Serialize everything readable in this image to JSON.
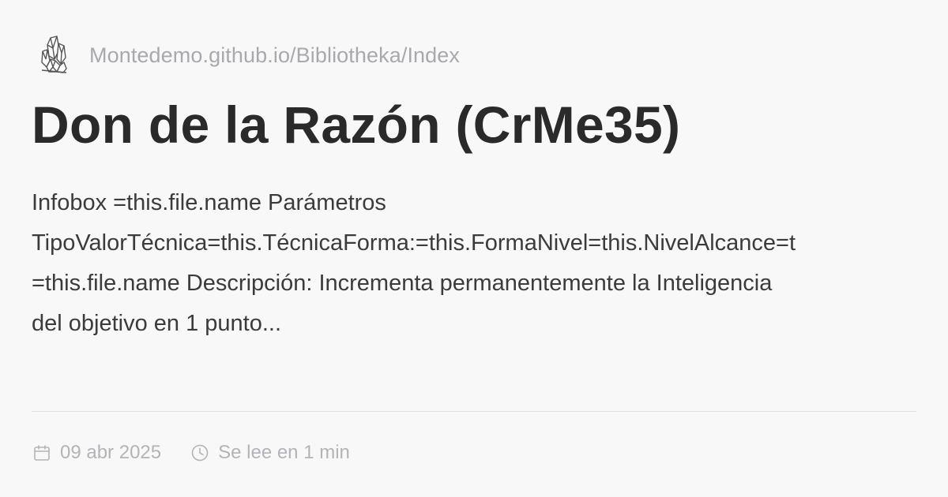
{
  "site": {
    "logo_icon": "crystal-cluster-icon",
    "name": "Montedemo.github.io/Bibliotheka/Index"
  },
  "page": {
    "title": "Don de la Razón (CrMe35)",
    "description_lines": [
      "Infobox =this.file.name Parámetros",
      "TipoValorTécnica=this.TécnicaForma:=this.FormaNivel=this.NivelAlcance=t",
      "=this.file.name Descripción: Incrementa permanentemente la Inteligencia",
      "del objetivo en 1 punto..."
    ]
  },
  "meta": {
    "date_icon": "calendar-icon",
    "date": "09 abr 2025",
    "read_icon": "clock-icon",
    "read_time": "Se lee en 1 min"
  },
  "colors": {
    "background": "#f8f8f9",
    "title": "#2a2a2a",
    "muted": "#a9a9ad",
    "divider": "#e3e3e6"
  }
}
